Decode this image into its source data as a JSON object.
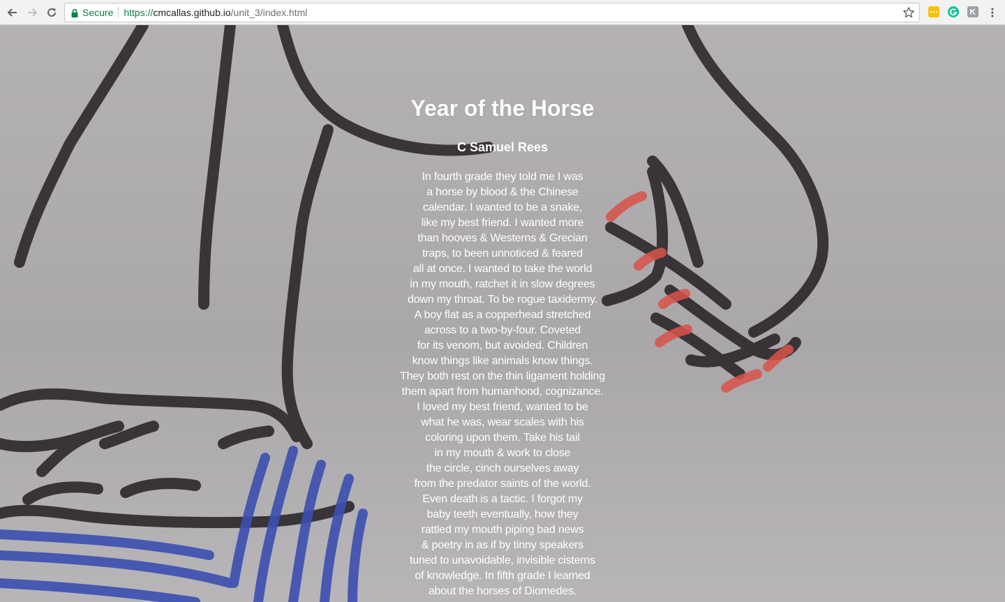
{
  "browser": {
    "secure_label": "Secure",
    "url_scheme": "https://",
    "url_host": "cmcallas.github.io",
    "url_path": "/unit_3/index.html"
  },
  "poem": {
    "title": "Year of the Horse",
    "author": "C Samuel Rees",
    "lines": [
      "In fourth grade they told me I was",
      "a horse by blood & the Chinese",
      "calendar. I wanted to be a snake,",
      "like my best friend. I wanted more",
      "than hooves & Westerns & Grecian",
      "traps, to been unnoticed & feared",
      "all at once. I wanted to take the world",
      "in my mouth, ratchet it in slow degrees",
      "down my throat. To be rogue taxidermy.",
      "A boy flat as a copperhead stretched",
      "across to a two-by-four. Coveted",
      "for its venom, but avoided. Children",
      "know things like animals know things.",
      "They both rest on the thin ligament holding",
      "them apart from humanhood, cognizance.",
      "I loved my best friend, wanted to be",
      "what he was, wear scales with his",
      "coloring upon them. Take his tail",
      "in my mouth & work to close",
      "the circle, cinch ourselves away",
      "from the predator saints of the world.",
      "Even death is a tactic. I forgot my",
      "baby teeth eventually, how they",
      "rattled my mouth piping bad news",
      "& poetry in as if by tinny speakers",
      "tuned to unavoidable, invisible cisterns",
      "of knowledge. In fifth grade I learned",
      "about the horses of Diomedes."
    ]
  },
  "colors": {
    "secure_green": "#0b8043",
    "ink_dark": "#2f2a2e",
    "ink_red": "#d9544a",
    "ink_blue": "#3b4fb0"
  },
  "icons": {
    "back": "back-arrow-icon",
    "forward": "forward-arrow-icon",
    "reload": "reload-icon",
    "lock": "lock-icon",
    "star": "star-icon",
    "menu": "kebab-menu-icon"
  }
}
